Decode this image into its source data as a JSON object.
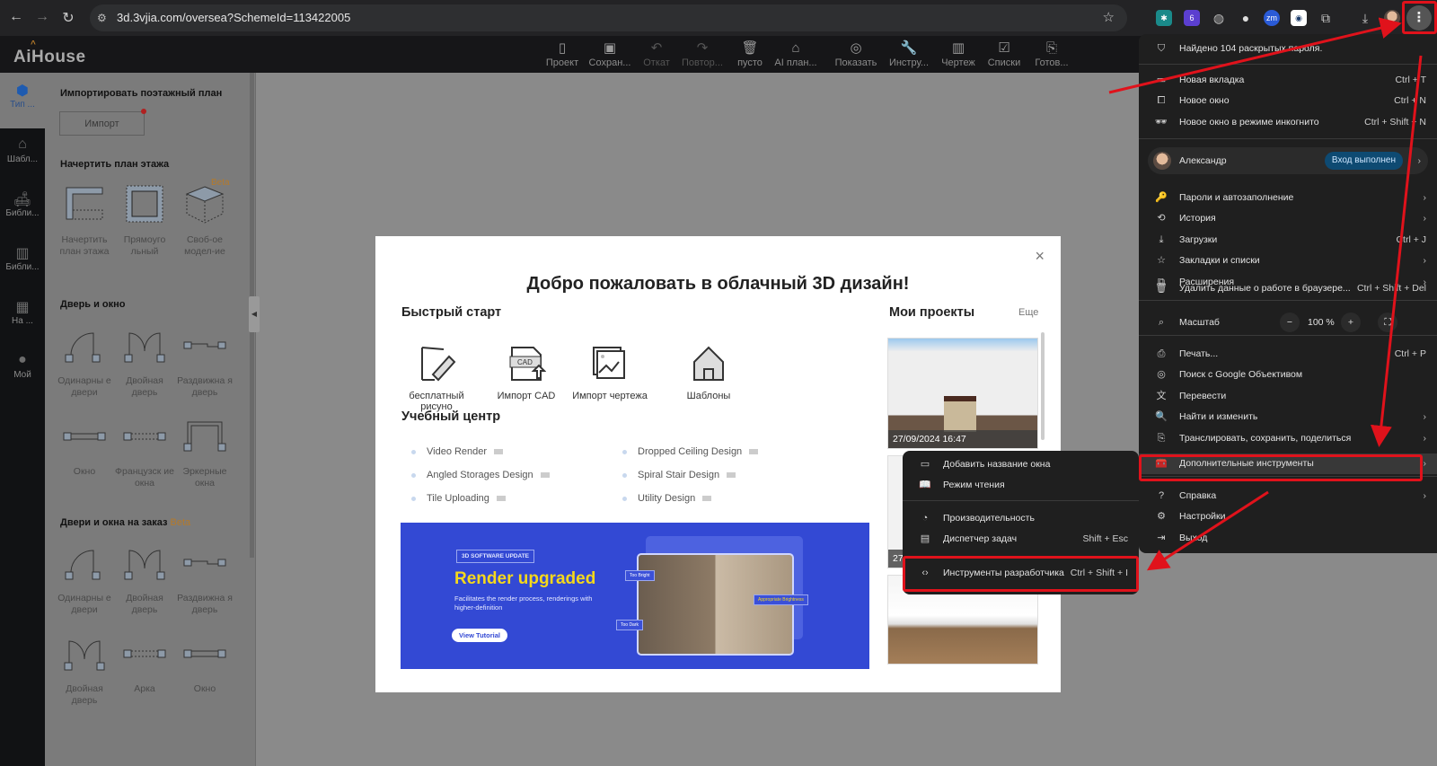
{
  "browser": {
    "url": "3d.3vjia.com/oversea?SchemeId=113422005",
    "extension_badge": "6",
    "extension_zm": "zm"
  },
  "app": {
    "logo": "AiHouse",
    "toolbar": [
      "Проект",
      "Сохран...",
      "Откат",
      "Повтор...",
      "пусто",
      "AI план...",
      "Показать",
      "Инстру...",
      "Чертеж",
      "Списки",
      "Готов..."
    ],
    "rail": [
      "Тип ...",
      "Шабл...",
      "Библи...",
      "Библи...",
      "На ...",
      "Мой"
    ]
  },
  "panel": {
    "import_heading": "Импортировать поэтажный план",
    "import_button": "Импорт",
    "draw_heading": "Начертить план этажа",
    "beta": "Beta",
    "draw_tiles": [
      "Начертить план этажа",
      "Прямоуго льный",
      "Своб-ое модел-ие"
    ],
    "door_heading": "Дверь и окно",
    "door_tiles": [
      "Одинарны е двери",
      "Двойная дверь",
      "Раздвижна я дверь",
      "Окно",
      "Французск ие окна",
      "Эркерные окна"
    ],
    "custom_heading": "Двери и окна на заказ",
    "custom_tiles": [
      "Одинарны е двери",
      "Двойная дверь",
      "Раздвижна я дверь",
      "Двойная дверь",
      "Арка",
      "Окно"
    ]
  },
  "modal": {
    "close": "×",
    "title": "Добро пожаловать в облачный 3D дизайн!",
    "quick_start": "Быстрый старт",
    "quick_items": [
      "бесплатный рисуно",
      "Импорт CAD",
      "Импорт чертежа",
      "Шаблоны"
    ],
    "cad_label": "CAD",
    "learning": "Учебный центр",
    "lessons": [
      "Video Render",
      "Angled Storages Design",
      "Tile Uploading",
      "Dropped Ceiling Design",
      "Spiral Stair Design",
      "Utility Design"
    ],
    "banner": {
      "tag": "3D SOFTWARE UPDATE",
      "title": "Render upgraded",
      "subtitle": "Facilitates the render process, renderings with higher-definition",
      "button": "View Tutorial",
      "pill_bright": "Too Bright",
      "pill_dark": "Too Dark",
      "pill_ok": "Appropriate Brightness"
    },
    "projects_title": "Мои проекты",
    "more": "Еще",
    "projects": [
      {
        "date": "27/09/2024 16:47"
      },
      {
        "date": "27"
      }
    ]
  },
  "menu": {
    "passwords_alert": "Найдено 104 раскрытых пароля.",
    "new_tab": "Новая вкладка",
    "new_tab_sc": "Ctrl + T",
    "new_window": "Новое окно",
    "new_window_sc": "Ctrl + N",
    "incognito": "Новое окно в режиме инкогнито",
    "incognito_sc": "Ctrl + Shift + N",
    "profile_name": "Александр",
    "profile_status": "Вход выполнен",
    "passwords": "Пароли и автозаполнение",
    "history": "История",
    "downloads": "Загрузки",
    "downloads_sc": "Ctrl + J",
    "bookmarks": "Закладки и списки",
    "extensions": "Расширения",
    "clear": "Удалить данные о работе в браузере...",
    "clear_sc": "Ctrl + Shift + Del",
    "zoom_label": "Масштаб",
    "zoom_value": "100 %",
    "zoom_minus": "−",
    "zoom_plus": "+",
    "print": "Печать...",
    "print_sc": "Ctrl + P",
    "lens": "Поиск с Google Объективом",
    "translate": "Перевести",
    "find": "Найти и изменить",
    "cast": "Транслировать, сохранить, поделиться",
    "more_tools": "Дополнительные инструменты",
    "help": "Справка",
    "settings": "Настройки",
    "exit": "Выход"
  },
  "submenu": {
    "name_window": "Добавить название окна",
    "reading": "Режим чтения",
    "performance": "Производительность",
    "task_manager": "Диспетчер задач",
    "task_manager_sc": "Shift + Esc",
    "devtools": "Инструменты разработчика",
    "devtools_sc": "Ctrl + Shift + I"
  },
  "colors": {
    "annotation_red": "#e0121b",
    "banner_blue": "#3349d4",
    "banner_yellow": "#f5d81c",
    "accent_beta": "#b57a2a"
  }
}
